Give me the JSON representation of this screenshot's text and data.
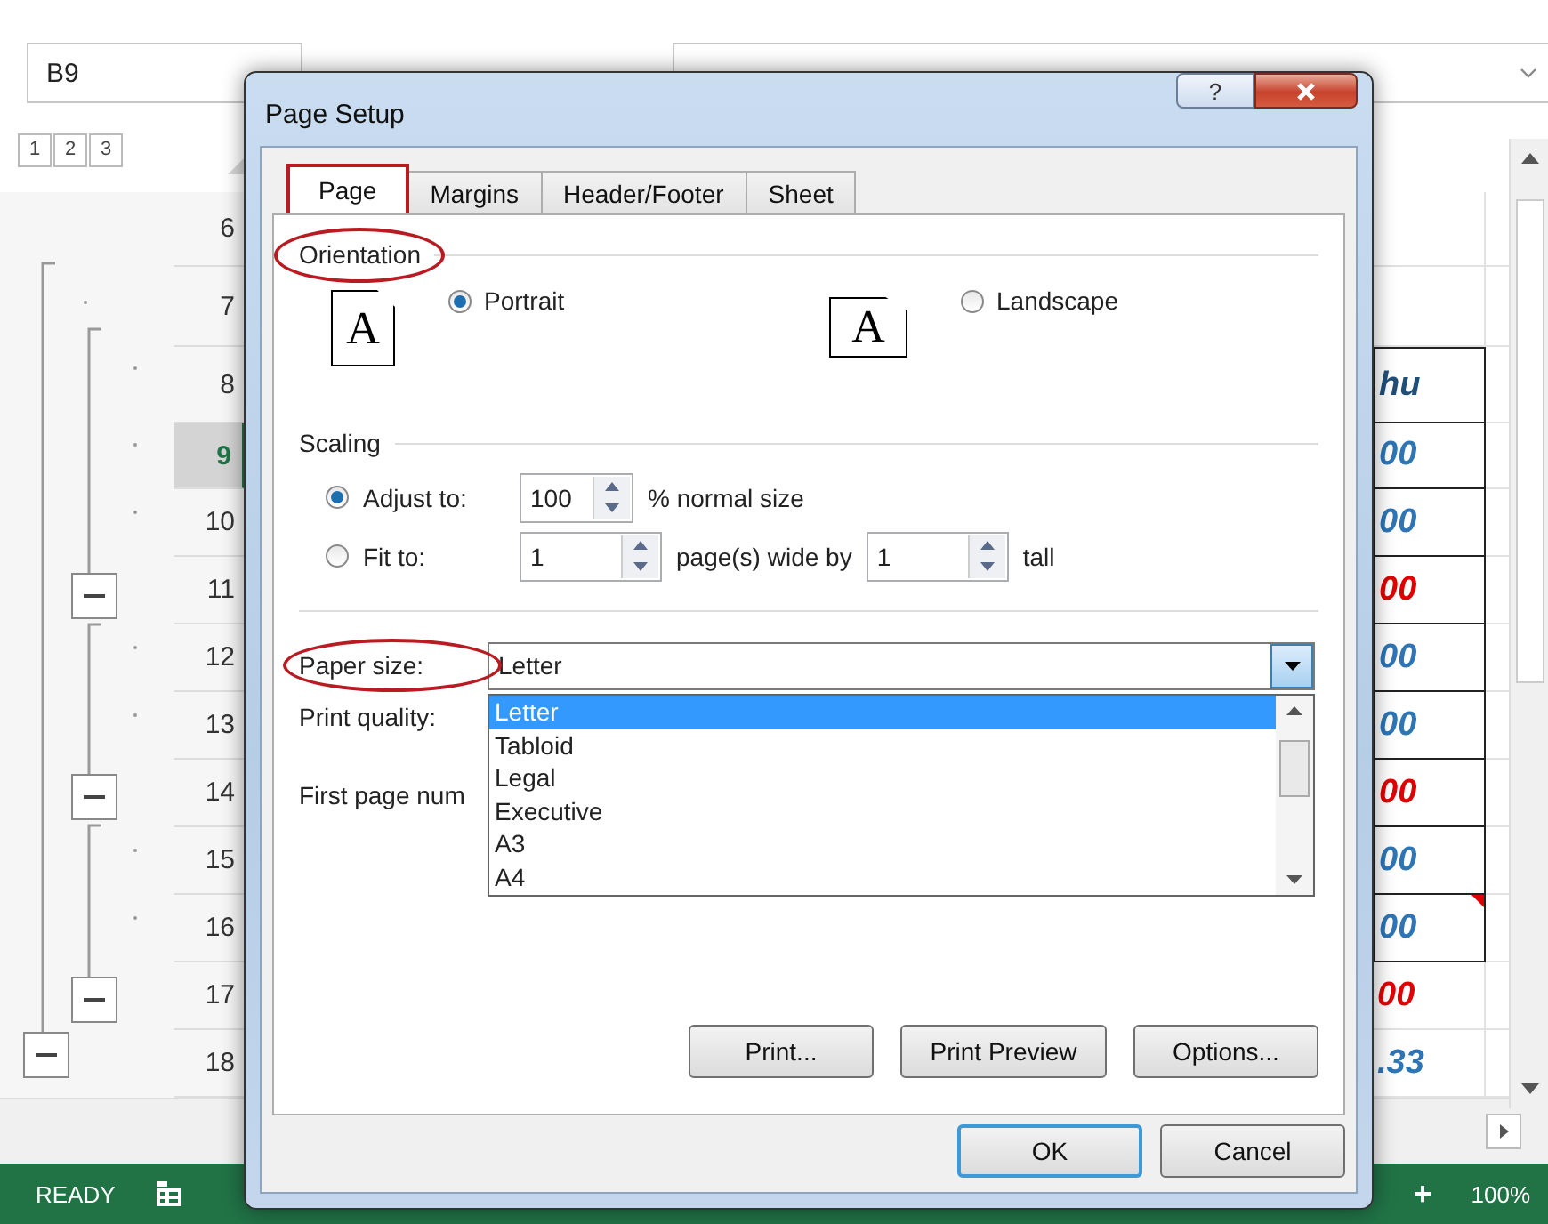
{
  "name_box": {
    "value": "B9"
  },
  "outline_levels": [
    "1",
    "2",
    "3"
  ],
  "rows": [
    {
      "number": "6",
      "selected": false
    },
    {
      "number": "7",
      "selected": false
    },
    {
      "number": "8",
      "selected": false,
      "cell": {
        "text": "hu",
        "color": "#1f4e79",
        "bordered": true,
        "comment": false
      }
    },
    {
      "number": "9",
      "selected": true,
      "cell": {
        "text": "00",
        "color": "#2e75b6",
        "bordered": true,
        "comment": false
      }
    },
    {
      "number": "10",
      "selected": false,
      "cell": {
        "text": "00",
        "color": "#2e75b6",
        "bordered": true,
        "comment": false
      }
    },
    {
      "number": "11",
      "selected": false,
      "cell": {
        "text": "00",
        "color": "#e00000",
        "bordered": true,
        "comment": false
      }
    },
    {
      "number": "12",
      "selected": false,
      "cell": {
        "text": "00",
        "color": "#2e75b6",
        "bordered": true,
        "comment": false
      }
    },
    {
      "number": "13",
      "selected": false,
      "cell": {
        "text": "00",
        "color": "#2e75b6",
        "bordered": true,
        "comment": false
      }
    },
    {
      "number": "14",
      "selected": false,
      "cell": {
        "text": "00",
        "color": "#e00000",
        "bordered": true,
        "comment": false
      }
    },
    {
      "number": "15",
      "selected": false,
      "cell": {
        "text": "00",
        "color": "#2e75b6",
        "bordered": true,
        "comment": false
      }
    },
    {
      "number": "16",
      "selected": false,
      "cell": {
        "text": "00",
        "color": "#2e75b6",
        "bordered": true,
        "comment": true
      }
    },
    {
      "number": "17",
      "selected": false,
      "cell": {
        "text": "00",
        "color": "#e00000",
        "bordered": false,
        "comment": false
      }
    },
    {
      "number": "18",
      "selected": false,
      "cell": {
        "text": ".33",
        "color": "#2e75b6",
        "bordered": false,
        "comment": false
      }
    }
  ],
  "status_bar": {
    "mode": "READY",
    "zoom_in": "+",
    "zoom": "100%"
  },
  "dialog": {
    "title": "Page Setup",
    "help": "?",
    "tabs": [
      {
        "label": "Page",
        "selected": true,
        "highlighted": true
      },
      {
        "label": "Margins",
        "selected": false,
        "highlighted": false
      },
      {
        "label": "Header/Footer",
        "selected": false,
        "highlighted": false
      },
      {
        "label": "Sheet",
        "selected": false,
        "highlighted": false
      }
    ],
    "orientation": {
      "heading": "Orientation",
      "circled": true,
      "options": [
        {
          "label": "Portrait",
          "glyph": "A",
          "kind": "portrait",
          "selected": true
        },
        {
          "label": "Landscape",
          "glyph": "A",
          "kind": "landscape",
          "selected": false
        }
      ]
    },
    "scaling": {
      "heading": "Scaling",
      "adjust": {
        "label": "Adjust to:",
        "selected": true,
        "value": "100",
        "suffix": "% normal size"
      },
      "fit": {
        "label": "Fit to:",
        "selected": false,
        "wide": "1",
        "wide_suffix": "page(s) wide by",
        "tall": "1",
        "tall_suffix": "tall"
      }
    },
    "paper_size": {
      "label": "Paper size:",
      "circled": true,
      "value": "Letter",
      "expanded": true,
      "options": [
        {
          "label": "Letter",
          "selected": true
        },
        {
          "label": "Tabloid",
          "selected": false
        },
        {
          "label": "Legal",
          "selected": false
        },
        {
          "label": "Executive",
          "selected": false
        },
        {
          "label": "A3",
          "selected": false
        },
        {
          "label": "A4",
          "selected": false
        }
      ]
    },
    "print_quality": {
      "label": "Print quality:"
    },
    "first_page": {
      "label": "First page num"
    },
    "buttons": [
      "Print...",
      "Print Preview",
      "Options..."
    ],
    "footer_buttons": [
      {
        "label": "OK",
        "default": true
      },
      {
        "label": "Cancel",
        "default": false
      }
    ]
  }
}
